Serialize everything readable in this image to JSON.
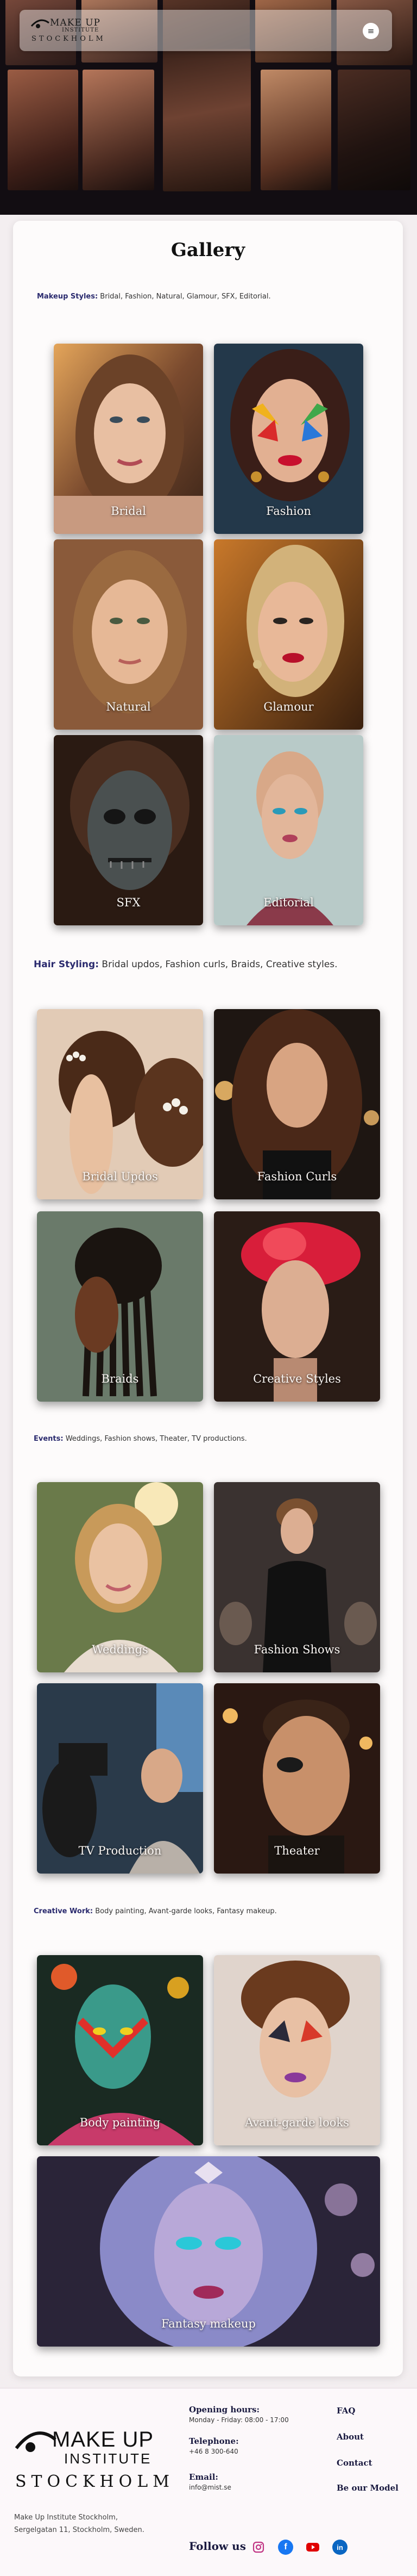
{
  "header": {
    "logo": {
      "line1": "MAKE UP",
      "line2": "INSTITUTE",
      "line3": "STOCKHOLM"
    },
    "menu_icon": "hamburger-icon"
  },
  "gallery": {
    "title": "Gallery",
    "sections": [
      {
        "category": "Makeup Styles:",
        "text": " Bridal, Fashion, Natural, Glamour, SFX, Editorial.",
        "items": [
          "Bridal",
          "Fashion",
          "Natural",
          "Glamour",
          "SFX",
          "Editorial"
        ]
      },
      {
        "category": "Hair Styling:",
        "text": " Bridal updos, Fashion curls, Braids, Creative styles.",
        "items": [
          "Bridal Updos",
          "Fashion Curls",
          "Braids",
          "Creative Styles"
        ]
      },
      {
        "category": "Events:",
        "text": " Weddings, Fashion shows, Theater, TV productions.",
        "items": [
          "Weddings",
          "Fashion Shows",
          "TV Production",
          "Theater"
        ]
      },
      {
        "category": "Creative Work:",
        "text": " Body painting, Avant-garde looks, Fantasy makeup.",
        "items": [
          "Body painting",
          "Avant-garde looks",
          "Fantasy  makeup"
        ]
      }
    ]
  },
  "footer": {
    "logo": {
      "line1": "MAKE UP",
      "line2": "INSTITUTE",
      "line3": "STOCKHOLM"
    },
    "address_line1": "Make Up Institute Stockholm,",
    "address_line2": "Sergelgatan 11, Stockholm, Sweden.",
    "opening_title": "Opening hours:",
    "opening_value": "Monday - Friday: 08:00 - 17:00",
    "telephone_title": "Telephone:",
    "telephone_value": "+46 8 300-640",
    "email_title": "Email:",
    "email_value": "info@mist.se",
    "links": [
      "FAQ",
      "About",
      "Contact",
      "Be our Model"
    ],
    "follow_label": "Follow us",
    "social": [
      {
        "icon": "instagram-icon",
        "color": "#c13584"
      },
      {
        "icon": "facebook-icon",
        "color": "#1877f2"
      },
      {
        "icon": "youtube-icon",
        "color": "#e00000"
      },
      {
        "icon": "linkedin-icon",
        "color": "#0a66c2"
      }
    ]
  },
  "colors": {
    "accent": "#2a2a6e",
    "page_bg": "#f3eef0",
    "card_bg": "#fdfbfb"
  }
}
